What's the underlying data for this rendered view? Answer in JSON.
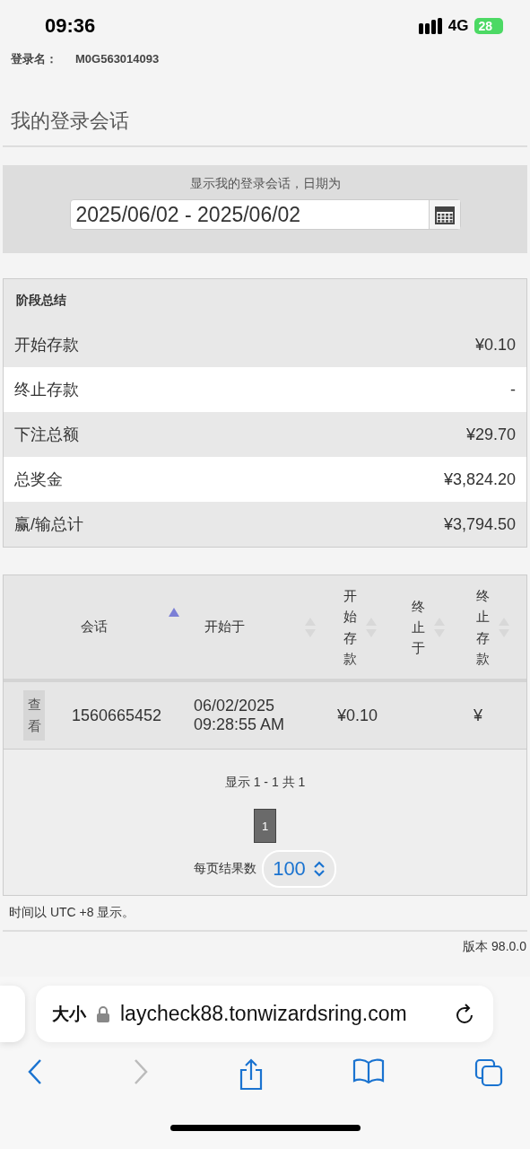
{
  "status_bar": {
    "time": "09:36",
    "network": "4G",
    "battery": "28"
  },
  "account": {
    "label": "登录名：",
    "value": "M0G563014093"
  },
  "page_title": "我的登录会话",
  "date_filter": {
    "label": "显示我的登录会话，日期为",
    "value": "2025/06/02 - 2025/06/02"
  },
  "summary": {
    "title": "阶段总结",
    "rows": [
      {
        "label": "开始存款",
        "value": "¥0.10"
      },
      {
        "label": "终止存款",
        "value": "-"
      },
      {
        "label": "下注总额",
        "value": "¥29.70"
      },
      {
        "label": "总奖金",
        "value": "¥3,824.20"
      },
      {
        "label": "赢/输总计",
        "value": "¥3,794.50"
      }
    ]
  },
  "sessions": {
    "columns": [
      {
        "label": "会话",
        "sorted": true
      },
      {
        "label": "开始于",
        "sorted": false
      },
      {
        "label": "开始存款",
        "sorted": false
      },
      {
        "label": "终止于",
        "sorted": false
      },
      {
        "label": "终止存款",
        "sorted": false
      }
    ],
    "rows": [
      {
        "action": "查看",
        "session": "1560665452",
        "started": "06/02/2025 09:28:55 AM",
        "start_deposit": "¥0.10",
        "end_deposit": "¥"
      }
    ]
  },
  "pagination": {
    "info": "显示 1 - 1 共 1",
    "pages": [
      {
        "label": "1",
        "selected": true
      }
    ],
    "per_page_label": "每页结果数",
    "per_page_value": "100"
  },
  "timezone_note": "时间以 UTC +8 显示。",
  "version": "版本 98.0.0",
  "browser": {
    "text_size": "大小",
    "url": "laycheck88.tonwizardsring.com",
    "back_disabled": false,
    "forward_disabled": true
  }
}
